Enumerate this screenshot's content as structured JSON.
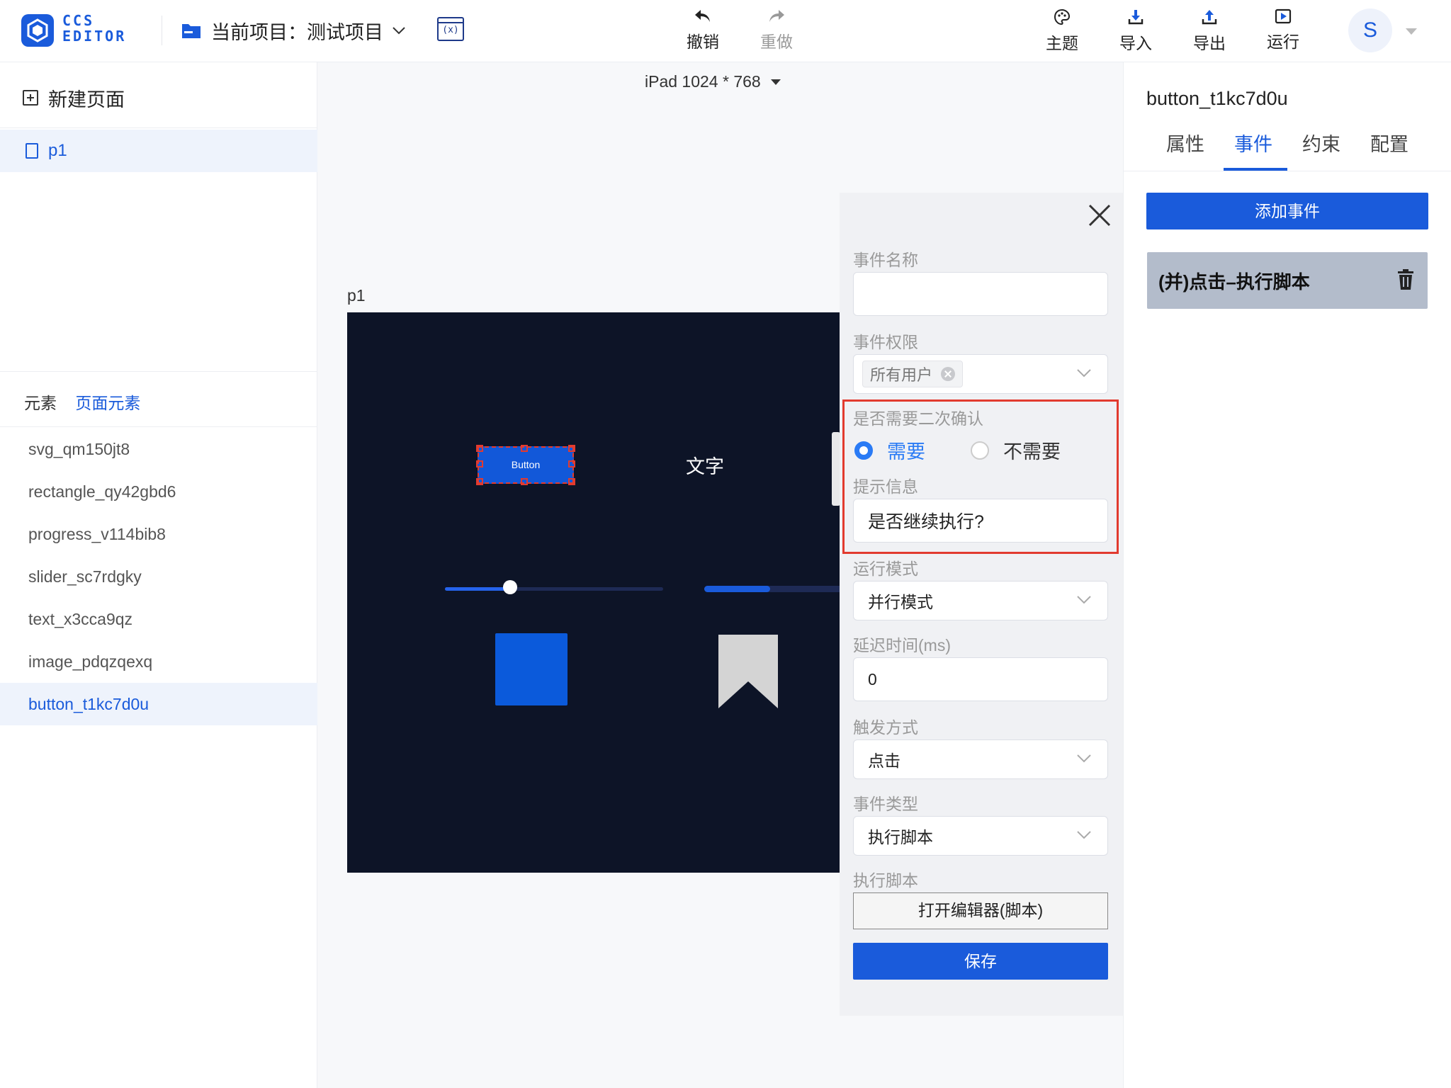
{
  "header": {
    "logo_text_line1": "CCS",
    "logo_text_line2": "EDITOR",
    "project_label": "当前项目：测试项目",
    "var_button_label": "(x)",
    "undo_label": "撤销",
    "redo_label": "重做",
    "theme_label": "主题",
    "import_label": "导入",
    "export_label": "导出",
    "run_label": "运行",
    "avatar_initial": "S"
  },
  "left": {
    "new_page_label": "新建页面",
    "pages": [
      {
        "label": "p1"
      }
    ],
    "tab_elements": "元素",
    "tab_page_elements": "页面元素",
    "elements": [
      {
        "label": "svg_qm150jt8"
      },
      {
        "label": "rectangle_qy42gbd6"
      },
      {
        "label": "progress_v114bib8"
      },
      {
        "label": "slider_sc7rdgky"
      },
      {
        "label": "text_x3cca9qz"
      },
      {
        "label": "image_pdqzqexq"
      },
      {
        "label": "button_t1kc7d0u"
      }
    ],
    "selected_element": "button_t1kc7d0u"
  },
  "canvas": {
    "device_label": "iPad 1024 * 768",
    "page_label": "p1",
    "button_text": "Button",
    "text_element": "文字",
    "slider_value": 0.3,
    "progress_value": 0.31,
    "colors": {
      "background": "#0d1427",
      "accent": "#1a5bdb",
      "selection": "#e23b2f"
    }
  },
  "event_form": {
    "name_label": "事件名称",
    "name_value": "",
    "permission_label": "事件权限",
    "permission_tag": "所有用户",
    "confirm_label": "是否需要二次确认",
    "confirm_options": [
      "需要",
      "不需要"
    ],
    "confirm_selected": "需要",
    "tip_label": "提示信息",
    "tip_value": "是否继续执行?",
    "run_mode_label": "运行模式",
    "run_mode_value": "并行模式",
    "delay_label": "延迟时间(ms)",
    "delay_value": "0",
    "trigger_label": "触发方式",
    "trigger_value": "点击",
    "type_label": "事件类型",
    "type_value": "执行脚本",
    "script_label": "执行脚本",
    "script_button": "打开编辑器(脚本)",
    "save_button": "保存"
  },
  "right": {
    "component_title": "button_t1kc7d0u",
    "tabs": [
      "属性",
      "事件",
      "约束",
      "配置"
    ],
    "active_tab": "事件",
    "add_event_button": "添加事件",
    "events": [
      {
        "label": "(并)点击–执行脚本"
      }
    ]
  }
}
